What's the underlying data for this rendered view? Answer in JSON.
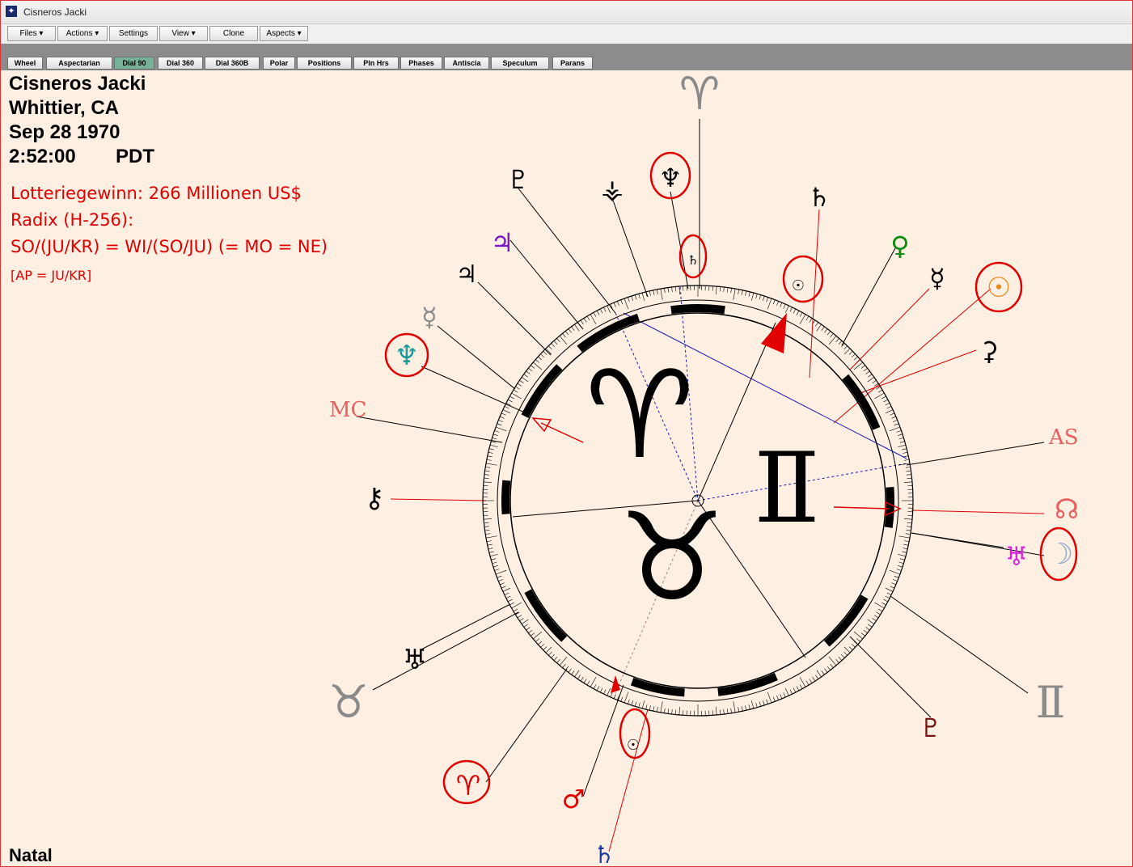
{
  "window": {
    "title": "Cisneros Jacki"
  },
  "toolbar": {
    "files": "Files ▾",
    "actions": "Actions ▾",
    "settings": "Settings",
    "view": "View ▾",
    "clone": "Clone",
    "aspects": "Aspects ▾"
  },
  "tabs": [
    "Wheel",
    "Aspectarian",
    "Dial 90",
    "Dial 360",
    "Dial 360B",
    "Polar",
    "Positions",
    "Pln Hrs",
    "Phases",
    "Antiscia",
    "Speculum",
    "Parans"
  ],
  "active_tab": "Dial 90",
  "chart_info": {
    "name": "Cisneros Jacki",
    "place": "Whittier, CA",
    "date": "Sep 28 1970",
    "time": "2:52:00",
    "zone": "PDT"
  },
  "notes": {
    "line1": "Lotteriegewinn: 266 Millionen US$",
    "line2": "Radix (H-256):",
    "line3": "SO/(JU/KR) = WI/(SO/JU) (= MO = NE)",
    "line4": "[AP = JU/KR]"
  },
  "footer": {
    "label": "Natal"
  },
  "dial": {
    "center_signs": {
      "aries": "♈",
      "taurus": "♉",
      "gemini": "Ⅱ"
    },
    "outer_signs": {
      "aries": "♈",
      "taurus": "♉",
      "gemini": "Ⅱ"
    },
    "mc": "MC",
    "as": "AS",
    "planets": {
      "sun": "☉",
      "moon": "☽",
      "mercury": "☿",
      "venus": "♀",
      "mars": "♂",
      "jupiter": "♃",
      "saturn": "♄",
      "uranus": "♅",
      "neptune": "♆",
      "pluto": "♇",
      "node": "☊",
      "chiron": "⚷",
      "ceres": "⚳",
      "pallas": "⚴",
      "ur_cupido": "⚵",
      "ur_hades": "♆",
      "ur_zeus": "♃",
      "ur_kronos": "♄",
      "ur_apollon": "⚲",
      "ur_admetos": "⚶",
      "ur_vulkanus": "♇",
      "ur_poseidon": "♅"
    }
  },
  "colors": {
    "background": "#fdefe2",
    "red": "#e00000",
    "orange": "#e88a1a",
    "green": "#0a8a0a",
    "magenta": "#e020e0",
    "purple": "#7a18c8",
    "teal": "#1a9a9a",
    "maroon": "#7a1010",
    "navy": "#1a3aa0",
    "grey": "#8a8a8a"
  }
}
